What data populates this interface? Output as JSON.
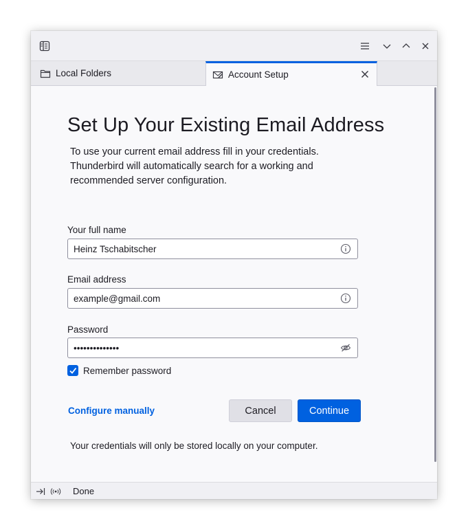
{
  "tabs": [
    {
      "label": "Local Folders",
      "icon": "folder-icon"
    },
    {
      "label": "Account Setup",
      "icon": "account-setup-icon"
    }
  ],
  "page": {
    "title": "Set Up Your Existing Email Address",
    "intro_lines": [
      "To use your current email address fill in your credentials.",
      "Thunderbird will automatically search for a working and",
      "recommended server configuration."
    ]
  },
  "form": {
    "name_label": "Your full name",
    "name_value": "Heinz Tschabitscher",
    "email_label": "Email address",
    "email_value": "example@gmail.com",
    "password_label": "Password",
    "password_value": "••••••••••••••",
    "remember_label": "Remember password",
    "remember_checked": true
  },
  "actions": {
    "configure_manually": "Configure manually",
    "cancel": "Cancel",
    "continue": "Continue"
  },
  "note": "Your credentials will only be stored locally on your computer.",
  "status": {
    "text": "Done"
  },
  "colors": {
    "accent": "#0061e0",
    "background": "#f9f9fb"
  }
}
